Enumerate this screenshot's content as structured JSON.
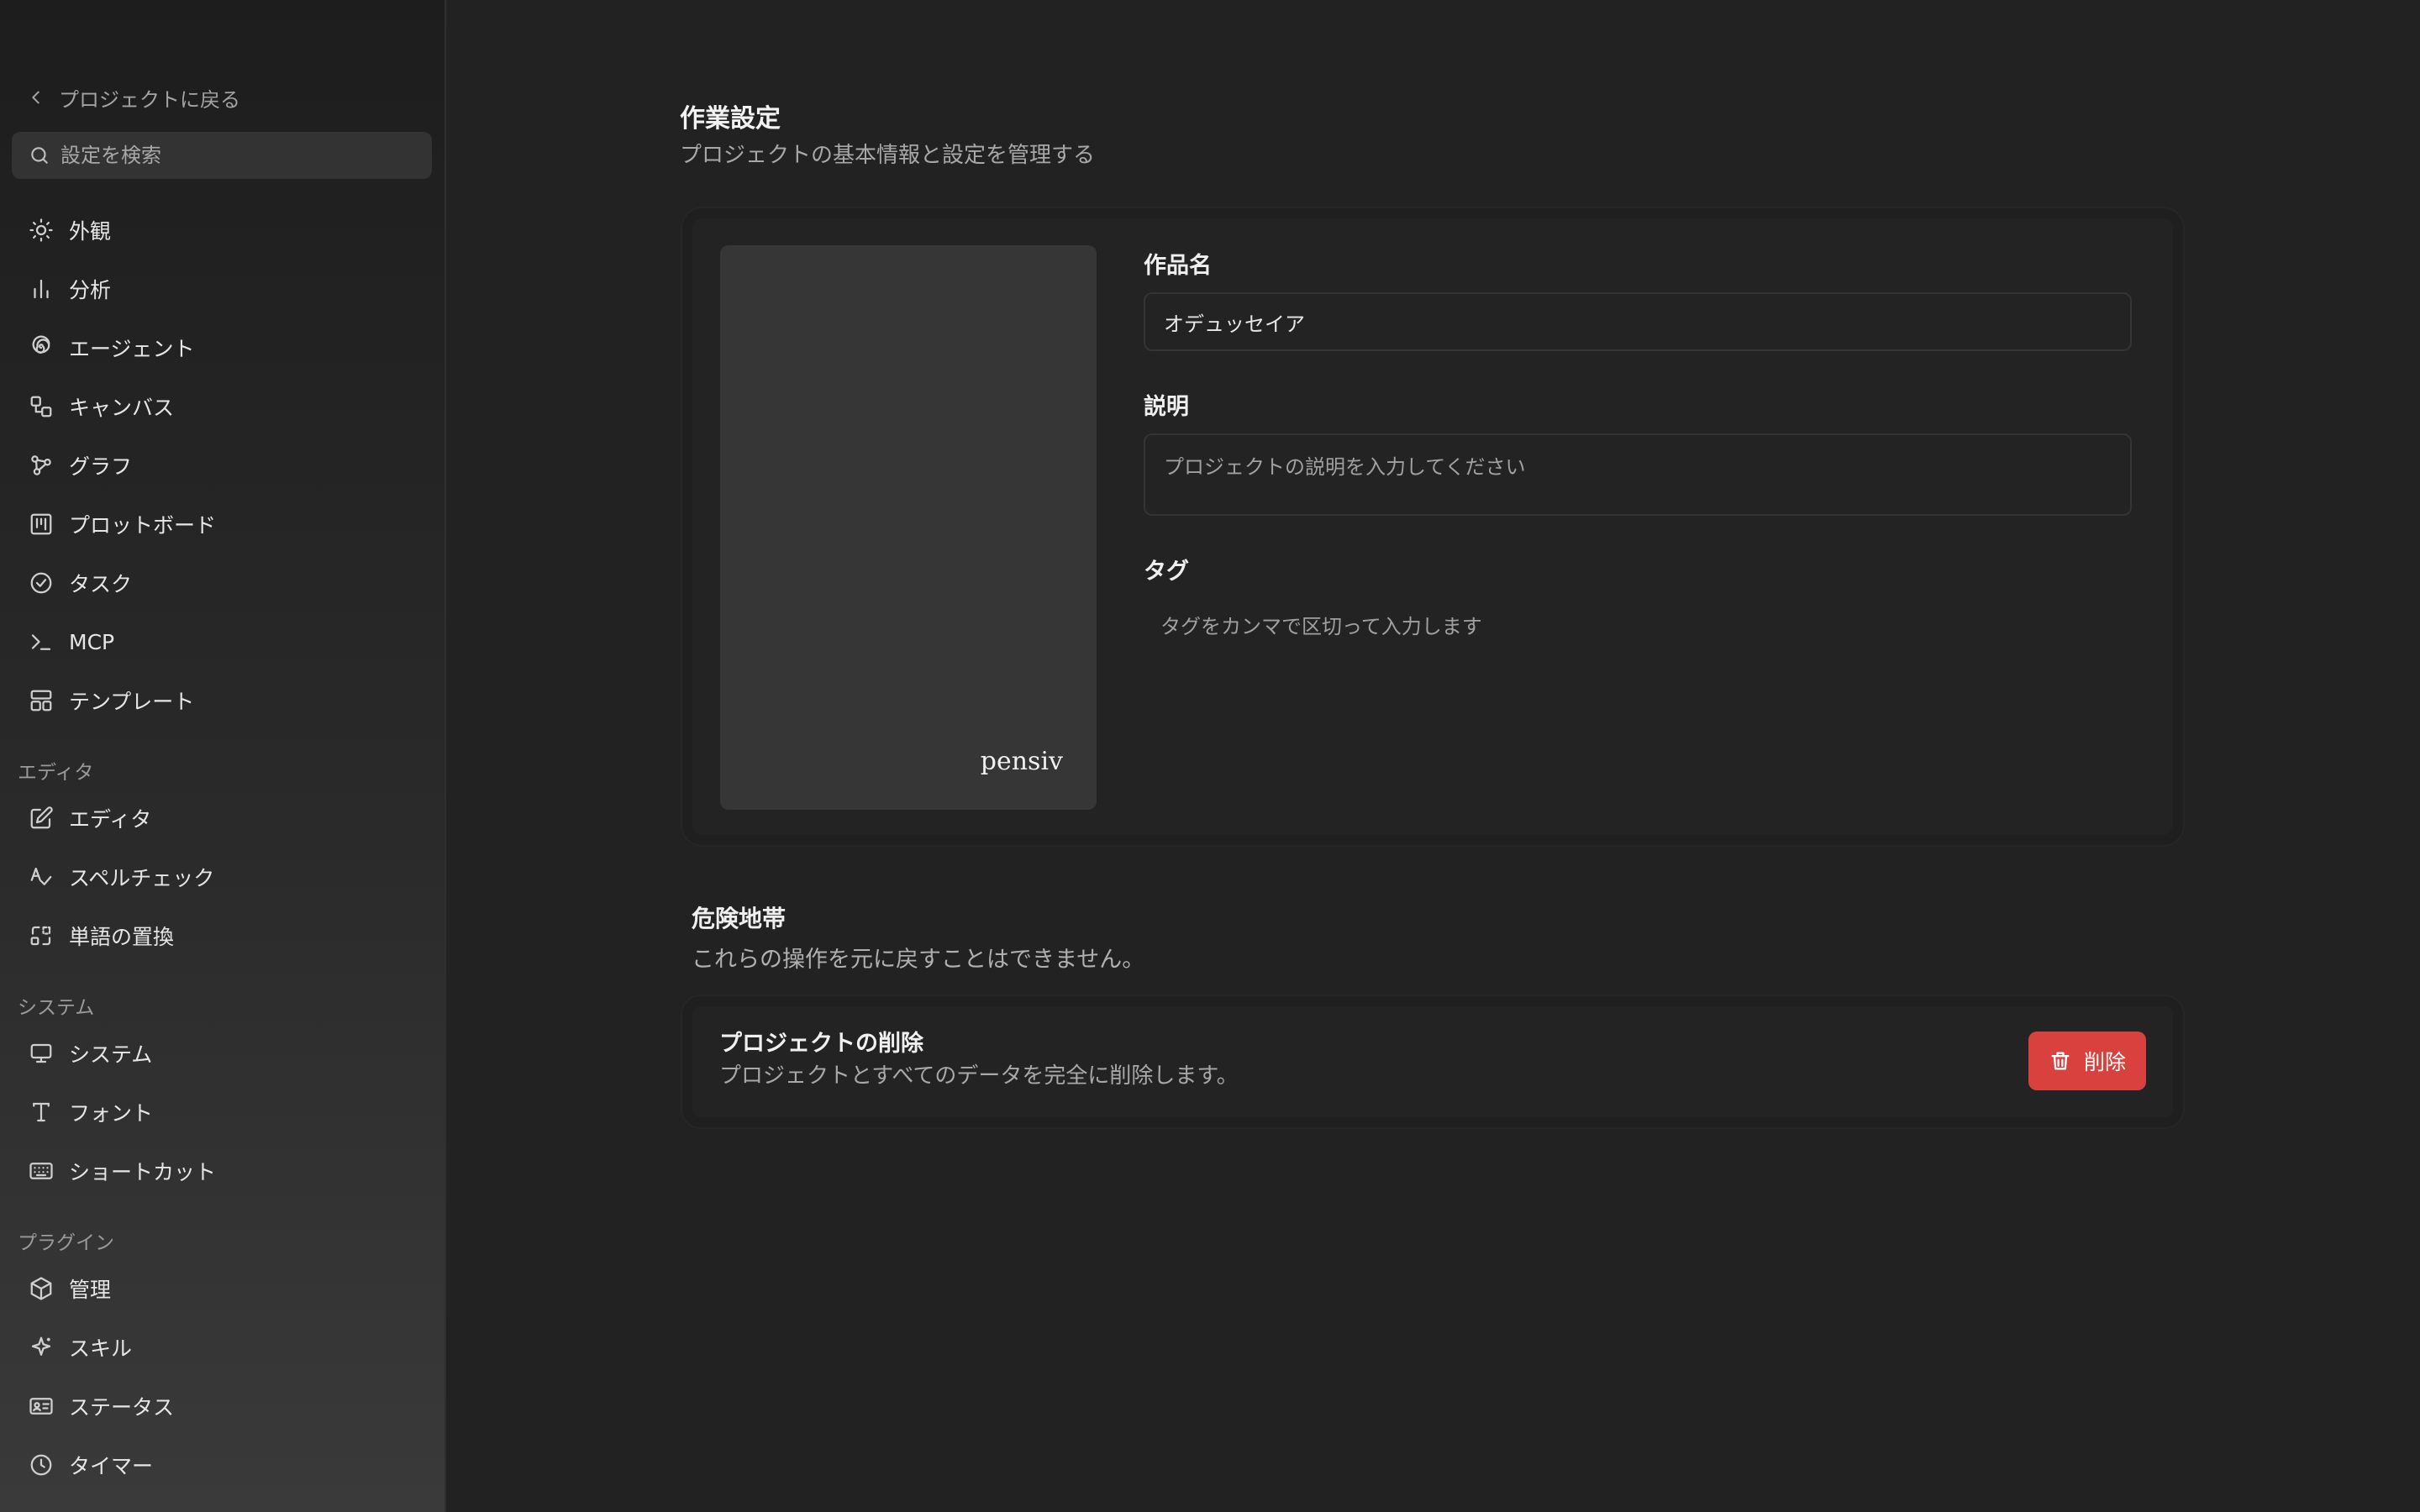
{
  "sidebar": {
    "back_label": "プロジェクトに戻る",
    "search_placeholder": "設定を検索",
    "items": [
      {
        "label": "外観",
        "icon": "sun-icon"
      },
      {
        "label": "分析",
        "icon": "bar-chart-icon"
      },
      {
        "label": "エージェント",
        "icon": "spiral-icon"
      },
      {
        "label": "キャンバス",
        "icon": "canvas-icon"
      },
      {
        "label": "グラフ",
        "icon": "graph-icon"
      },
      {
        "label": "プロットボード",
        "icon": "kanban-icon"
      },
      {
        "label": "タスク",
        "icon": "check-circle-icon"
      },
      {
        "label": "MCP",
        "icon": "terminal-icon"
      },
      {
        "label": "テンプレート",
        "icon": "layout-template-icon"
      }
    ],
    "sections": {
      "editor": {
        "title": "エディタ",
        "items": [
          {
            "label": "エディタ",
            "icon": "pencil-square-icon"
          },
          {
            "label": "スペルチェック",
            "icon": "spell-check-icon"
          },
          {
            "label": "単語の置換",
            "icon": "replace-icon"
          }
        ]
      },
      "system": {
        "title": "システム",
        "items": [
          {
            "label": "システム",
            "icon": "monitor-icon"
          },
          {
            "label": "フォント",
            "icon": "type-icon"
          },
          {
            "label": "ショートカット",
            "icon": "keyboard-icon"
          }
        ]
      },
      "plugin": {
        "title": "プラグイン",
        "items": [
          {
            "label": "管理",
            "icon": "package-icon"
          },
          {
            "label": "スキル",
            "icon": "sparkle-icon"
          },
          {
            "label": "ステータス",
            "icon": "id-card-icon"
          },
          {
            "label": "タイマー",
            "icon": "clock-icon"
          }
        ]
      }
    }
  },
  "main": {
    "title": "作業設定",
    "subtitle": "プロジェクトの基本情報と設定を管理する",
    "cover_brand": "pensiv",
    "fields": {
      "name": {
        "label": "作品名",
        "value": "オデュッセイア"
      },
      "description": {
        "label": "説明",
        "placeholder": "プロジェクトの説明を入力してください"
      },
      "tags": {
        "label": "タグ",
        "placeholder": "タグをカンマで区切って入力します"
      }
    },
    "danger": {
      "title": "危険地帯",
      "description": "これらの操作を元に戻すことはできません。",
      "delete_title": "プロジェクトの削除",
      "delete_description": "プロジェクトとすべてのデータを完全に削除します。",
      "delete_button": "削除"
    }
  },
  "colors": {
    "background": "#222222",
    "danger": "#d8413e"
  }
}
